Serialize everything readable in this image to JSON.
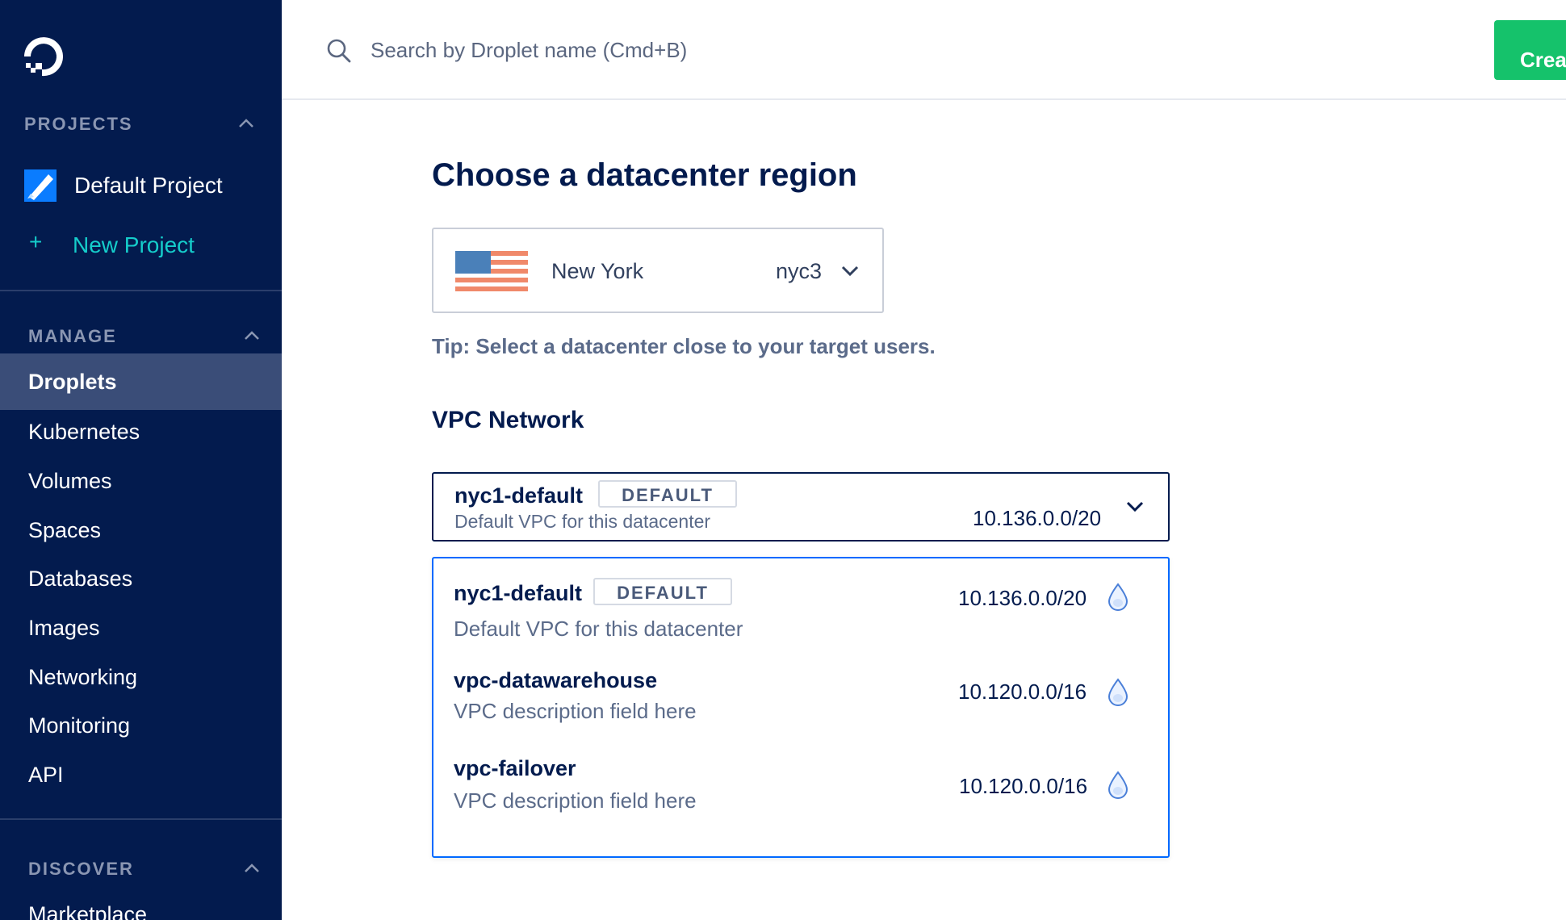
{
  "sidebar": {
    "projects_header": "PROJECTS",
    "projects": [
      {
        "label": "Default Project"
      }
    ],
    "new_project_plus": "+",
    "new_project_label": "New Project",
    "manage_header": "MANAGE",
    "manage_items": [
      {
        "label": "Droplets",
        "active": true
      },
      {
        "label": "Kubernetes"
      },
      {
        "label": "Volumes"
      },
      {
        "label": "Spaces"
      },
      {
        "label": "Databases"
      },
      {
        "label": "Images"
      },
      {
        "label": "Networking"
      },
      {
        "label": "Monitoring"
      },
      {
        "label": "API"
      }
    ],
    "discover_header": "DISCOVER",
    "discover_items": [
      {
        "label": "Marketplace"
      }
    ]
  },
  "topbar": {
    "search_placeholder": "Search by Droplet name (Cmd+B)",
    "create_label": "Creat"
  },
  "main": {
    "title": "Choose a datacenter region",
    "region": {
      "name": "New York",
      "code": "nyc3"
    },
    "tip": "Tip: Select a datacenter close to your target users.",
    "vpc_title": "VPC Network",
    "vpc_selected": {
      "name": "nyc1-default",
      "badge": "DEFAULT",
      "description": "Default VPC for this datacenter",
      "cidr": "10.136.0.0/20"
    },
    "vpc_options": [
      {
        "name": "nyc1-default",
        "badge": "DEFAULT",
        "description": "Default VPC for this datacenter",
        "cidr": "10.136.0.0/20"
      },
      {
        "name": "vpc-datawarehouse",
        "description": "VPC description field here",
        "cidr": "10.120.0.0/16"
      },
      {
        "name": "vpc-failover",
        "description": "VPC description field here",
        "cidr": "10.120.0.0/16"
      }
    ]
  },
  "colors": {
    "sidebar_bg": "#031b4e",
    "accent_teal": "#15cdcb",
    "create_green": "#15c26b",
    "focus_blue": "#0069ff"
  },
  "icons": [
    "logo-icon",
    "chevron-up-icon",
    "project-icon",
    "search-icon",
    "us-flag-icon",
    "chevron-down-icon",
    "droplet-icon"
  ]
}
